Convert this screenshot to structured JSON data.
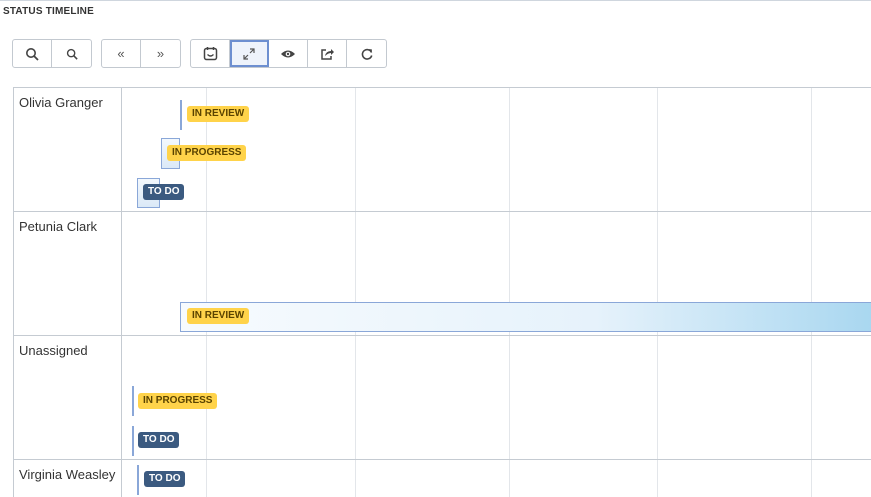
{
  "title": "STATUS TIMELINE",
  "toolbar": {
    "buttons": [
      {
        "icon": "zoom-in-icon"
      },
      {
        "icon": "zoom-out-icon"
      },
      {
        "icon": "prev-icon",
        "glyph": "«"
      },
      {
        "icon": "next-icon",
        "glyph": "»"
      },
      {
        "icon": "calendar-icon"
      },
      {
        "icon": "fit-icon",
        "active": true
      },
      {
        "icon": "eye-icon"
      },
      {
        "icon": "share-icon"
      },
      {
        "icon": "refresh-icon"
      }
    ]
  },
  "rows": [
    {
      "name": "Olivia Granger",
      "items": [
        "IN REVIEW",
        "IN PROGRESS",
        "TO DO"
      ]
    },
    {
      "name": "Petunia Clark",
      "items": [
        "IN REVIEW"
      ]
    },
    {
      "name": "Unassigned",
      "items": [
        "IN PROGRESS",
        "TO DO"
      ]
    },
    {
      "name": "Virginia Weasley",
      "items": [
        "TO DO"
      ]
    }
  ],
  "colors": {
    "in_progress": "#ffd34a",
    "in_review": "#ffd34a",
    "to_do": "#3b5a80",
    "accent": "#6d8fd0"
  }
}
